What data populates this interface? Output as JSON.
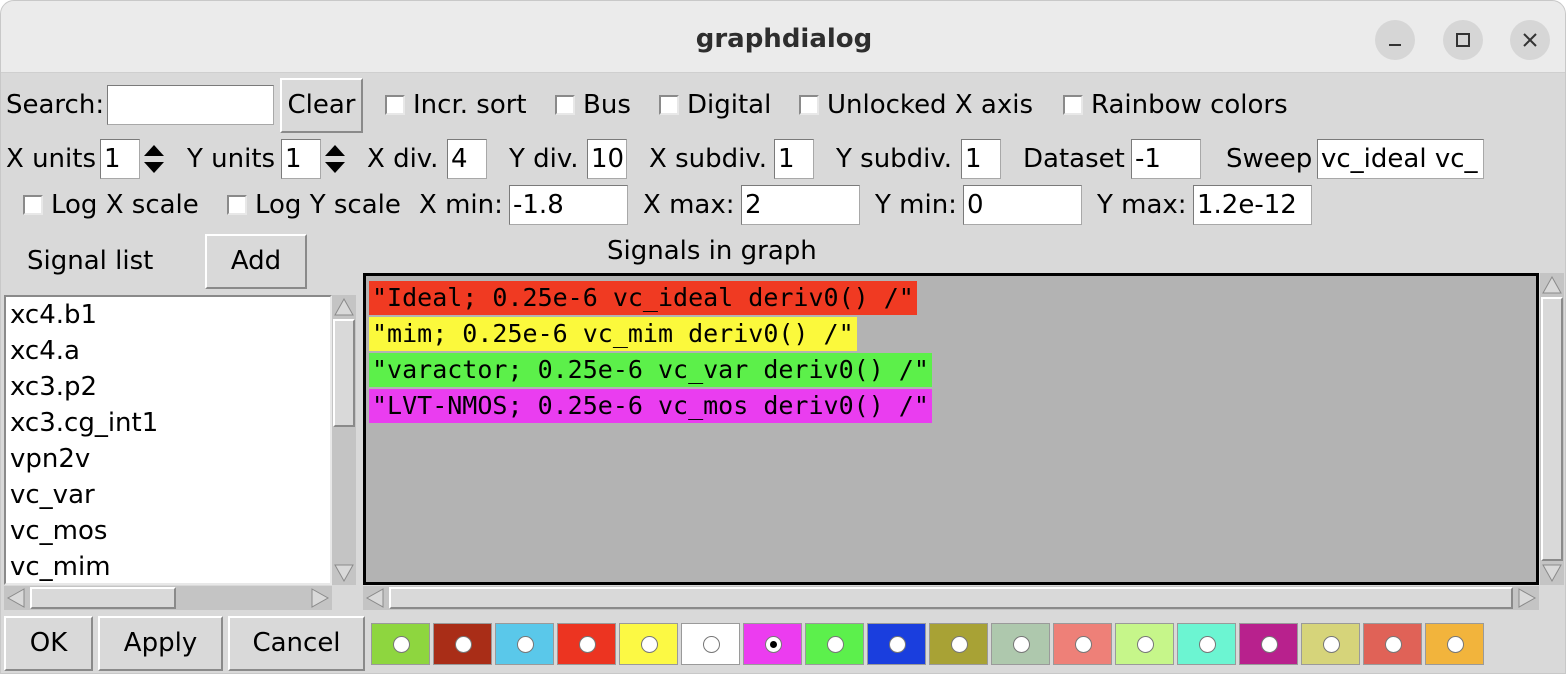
{
  "window": {
    "title": "graphdialog"
  },
  "row1": {
    "search_label": "Search:",
    "search_value": "",
    "clear_label": "Clear",
    "incr_sort": "Incr. sort",
    "bus": "Bus",
    "digital": "Digital",
    "unlocked_x": "Unlocked X axis",
    "rainbow": "Rainbow colors"
  },
  "row2": {
    "x_units_label": "X units",
    "x_units_value": "1",
    "y_units_label": "Y units",
    "y_units_value": "1",
    "x_div_label": "X div.",
    "x_div_value": "4",
    "y_div_label": "Y div.",
    "y_div_value": "10",
    "x_subdiv_label": "X subdiv.",
    "x_subdiv_value": "1",
    "y_subdiv_label": "Y subdiv.",
    "y_subdiv_value": "1",
    "dataset_label": "Dataset",
    "dataset_value": "-1",
    "sweep_label": "Sweep",
    "sweep_value": "vc_ideal vc_"
  },
  "row3": {
    "log_x": "Log X scale",
    "log_y": "Log Y scale",
    "x_min_label": "X min:",
    "x_min_value": "-1.8",
    "x_max_label": "X max:",
    "x_max_value": "2",
    "y_min_label": "Y min:",
    "y_min_value": "0",
    "y_max_label": "Y max:",
    "y_max_value": "1.2e-12"
  },
  "signal_list": {
    "label": "Signal list",
    "add_label": "Add",
    "items": [
      "xc4.b1",
      "xc4.a",
      "xc3.p2",
      "xc3.cg_int1",
      "vpn2v",
      "vc_var",
      "vc_mos",
      "vc_mim"
    ]
  },
  "graph": {
    "label": "Signals in graph",
    "signals": [
      {
        "text": "\"Ideal; 0.25e-6 vc_ideal deriv0() /\"",
        "color": "#f03a22"
      },
      {
        "text": "\"mim; 0.25e-6 vc_mim deriv0() /\"",
        "color": "#fbf93c"
      },
      {
        "text": "\"varactor; 0.25e-6 vc_var deriv0() /\"",
        "color": "#5cf04a"
      },
      {
        "text": "\"LVT-NMOS; 0.25e-6 vc_mos deriv0() /\"",
        "color": "#ea3df0"
      }
    ]
  },
  "buttons": {
    "ok": "OK",
    "apply": "Apply",
    "cancel": "Cancel"
  },
  "palette": {
    "colors": [
      "#8ed63f",
      "#a92d17",
      "#5ac8ea",
      "#ec3421",
      "#fcf944",
      "#ffffff",
      "#ec3cf0",
      "#5cf04c",
      "#1a3ede",
      "#a8a235",
      "#aec8ad",
      "#ee8078",
      "#c6f68a",
      "#6cf5d2",
      "#b8218d",
      "#d6d47a",
      "#e06257",
      "#f2b43c"
    ],
    "selected_index": 6
  }
}
